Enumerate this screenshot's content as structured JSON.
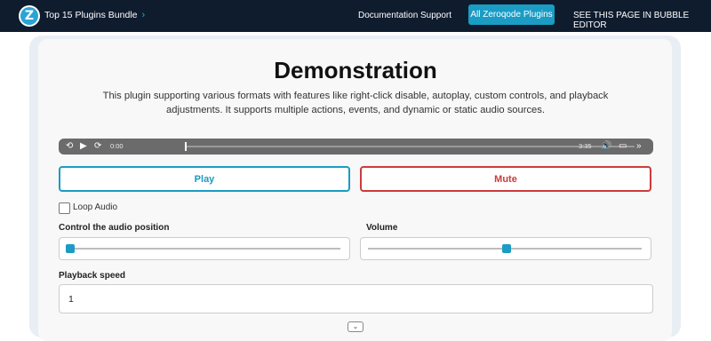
{
  "header": {
    "logo_letter": "Z",
    "bundle_label": "Top 15 Plugins Bundle",
    "chevron_icon": "chevron-right-icon",
    "nav": {
      "documentation": "Documentation",
      "support": "Support",
      "all_plugins": "All Zeroqode Plugins",
      "editor": "SEE THIS PAGE IN BUBBLE EDITOR"
    },
    "bg_color": "#0f1c2e",
    "accent_color": "#1a9cc4"
  },
  "main": {
    "title": "Demonstration",
    "description": "This plugin supporting various formats with features like right-click disable, autoplay, custom controls, and playback adjustments. It supports multiple actions, events, and dynamic or static audio sources."
  },
  "player": {
    "current_time": "0:00",
    "duration": "3:35",
    "progress_fraction": 0,
    "icons": [
      "rewind-icon",
      "play-icon",
      "forward-icon",
      "volume-icon",
      "airplay-icon",
      "more-icon"
    ]
  },
  "buttons": {
    "play_label": "Play",
    "mute_label": "Mute",
    "play_color": "#1a9cc4",
    "mute_color": "#cc3b3b"
  },
  "loop": {
    "label": "Loop Audio",
    "checked": false
  },
  "position_control": {
    "label": "Control the audio position",
    "value_fraction": 0
  },
  "volume_control": {
    "label": "Volume",
    "value_fraction": 0.5
  },
  "speed": {
    "label": "Playback speed",
    "value": "1"
  }
}
